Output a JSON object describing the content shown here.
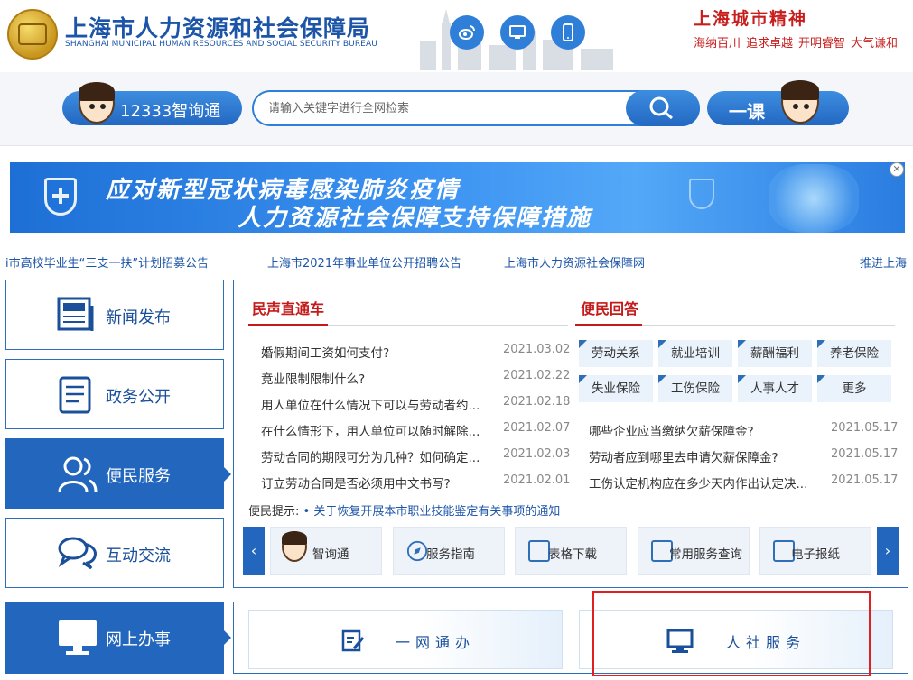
{
  "header": {
    "org_name_cn": "上海市人力资源和社会保障局",
    "org_name_en": "SHANGHAI MUNICIPAL HUMAN RESOURCES AND SOCIAL SECURITY BUREAU",
    "icons": [
      "weibo-icon",
      "desktop-icon",
      "mobile-icon"
    ],
    "spirit_title": "上海城市精神",
    "spirit_words": [
      "海纳百川",
      "追求卓越",
      "开明睿智",
      "大气谦和"
    ]
  },
  "search": {
    "hotline_label": "12333智询通",
    "placeholder": "请输入关键字进行全网检索",
    "course_label": "一课"
  },
  "banner": {
    "line1": "应对新型冠状病毒感染肺炎疫情",
    "line2": "人力资源社会保障支持保障措施"
  },
  "ticker": [
    "i市高校毕业生“三支一扶”计划招募公告",
    "上海市2021年事业单位公开招聘公告",
    "上海市人力资源社会保障网",
    "推进上海"
  ],
  "nav": [
    {
      "label": "新闻发布",
      "active": false
    },
    {
      "label": "政务公开",
      "active": false
    },
    {
      "label": "便民服务",
      "active": true
    },
    {
      "label": "互动交流",
      "active": false
    },
    {
      "label": "网上办事",
      "active": true
    }
  ],
  "voices": {
    "title": "民声直通车",
    "items": [
      {
        "title": "婚假期间工资如何支付?",
        "date": "2021.03.02"
      },
      {
        "title": "竞业限制限制什么?",
        "date": "2021.02.22"
      },
      {
        "title": "用人单位在什么情况下可以与劳动者约...",
        "date": "2021.02.18"
      },
      {
        "title": "在什么情形下，用人单位可以随时解除...",
        "date": "2021.02.07"
      },
      {
        "title": "劳动合同的期限可分为几种？如何确定...",
        "date": "2021.02.03"
      },
      {
        "title": "订立劳动合同是否必须用中文书写?",
        "date": "2021.02.01"
      }
    ]
  },
  "qa": {
    "title": "便民回答",
    "tags": [
      "劳动关系",
      "就业培训",
      "薪酬福利",
      "养老保险",
      "失业保险",
      "工伤保险",
      "人事人才",
      "更多"
    ],
    "items": [
      {
        "title": "哪些企业应当缴纳欠薪保障金?",
        "date": "2021.05.17"
      },
      {
        "title": "劳动者应到哪里去申请欠薪保障金?",
        "date": "2021.05.17"
      },
      {
        "title": "工伤认定机构应在多少天内作出认定决...",
        "date": "2021.05.17"
      }
    ]
  },
  "tip": {
    "label": "便民提示:",
    "link": "• 关于恢复开展本市职业技能鉴定有关事项的通知"
  },
  "services": [
    {
      "label": "智询通",
      "icon": "assistant-avatar-icon"
    },
    {
      "label": "服务指南",
      "icon": "compass-icon"
    },
    {
      "label": "表格下载",
      "icon": "table-icon"
    },
    {
      "label": "常用服务查询",
      "icon": "search-doc-icon"
    },
    {
      "label": "电子报纸",
      "icon": "newspaper-icon"
    }
  ],
  "online": {
    "left_label": "一网通办",
    "right_label": "人社服务"
  },
  "colors": {
    "brand_blue": "#2266bd",
    "accent_red": "#c41a1a",
    "highlight_red": "#e02020"
  }
}
